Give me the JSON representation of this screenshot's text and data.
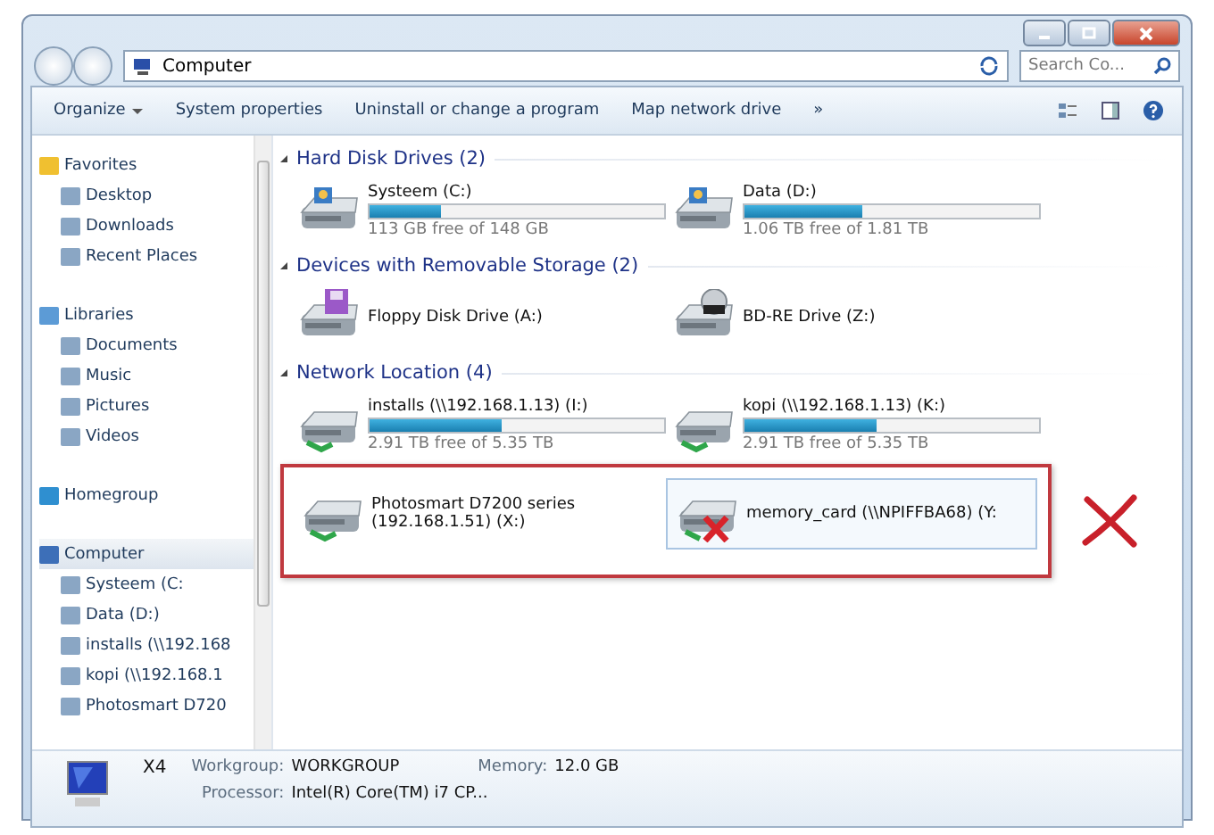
{
  "address_bar": {
    "path": [
      "Computer"
    ]
  },
  "search": {
    "placeholder": "Search Co..."
  },
  "toolbar": {
    "items": [
      {
        "label": "Organize",
        "dropdown": true
      },
      {
        "label": "System properties",
        "dropdown": false
      },
      {
        "label": "Uninstall or change a program",
        "dropdown": false
      },
      {
        "label": "Map network drive",
        "dropdown": false
      },
      {
        "label": "»",
        "dropdown": false
      }
    ]
  },
  "sidebar": {
    "items": [
      {
        "label": "Favorites",
        "selected": false,
        "children": [
          {
            "label": "Desktop",
            "selected": false
          },
          {
            "label": "Downloads",
            "selected": false
          },
          {
            "label": "Recent Places",
            "selected": false
          }
        ]
      },
      {
        "label": "Libraries",
        "selected": false,
        "children": [
          {
            "label": "Documents",
            "selected": false
          },
          {
            "label": "Music",
            "selected": false
          },
          {
            "label": "Pictures",
            "selected": false
          },
          {
            "label": "Videos",
            "selected": false
          }
        ]
      },
      {
        "label": "Homegroup",
        "selected": false
      },
      {
        "label": "Computer",
        "selected": true,
        "children": [
          {
            "label": "Systeem (C:",
            "selected": false
          },
          {
            "label": "Data (D:)",
            "selected": false
          },
          {
            "label": "installs (\\\\192.168",
            "selected": false
          },
          {
            "label": "kopi (\\\\192.168.1",
            "selected": false
          },
          {
            "label": "Photosmart D720",
            "selected": false
          }
        ]
      }
    ]
  },
  "groups": [
    {
      "title": "Hard Disk Drives (2)",
      "expanded": true,
      "items": [
        {
          "kind": "disk",
          "name": "Systeem (C:)",
          "level": 0.24,
          "space": "113 GB free of 148 GB",
          "selected": false,
          "flagged": false
        },
        {
          "kind": "disk",
          "name": "Data (D:)",
          "level": 0.4,
          "space": "1.06 TB free of 1.81 TB",
          "selected": false,
          "flagged": false
        }
      ]
    },
    {
      "title": "Devices with Removable Storage (2)",
      "expanded": true,
      "items": [
        {
          "kind": "floppy",
          "name": "Floppy Disk Drive (A:)",
          "selected": false,
          "flagged": false
        },
        {
          "kind": "optical",
          "name": "BD-RE Drive (Z:)",
          "selected": false,
          "flagged": false
        }
      ]
    },
    {
      "title": "Network Location (4)",
      "expanded": true,
      "items": [
        {
          "kind": "network",
          "name": "installs (\\\\192.168.1.13) (I:)",
          "level": 0.45,
          "space": "2.91 TB free of 5.35 TB",
          "selected": false,
          "flagged": false
        },
        {
          "kind": "network",
          "name": "kopi (\\\\192.168.1.13) (K:)",
          "level": 0.45,
          "space": "2.91 TB free of 5.35 TB",
          "selected": false,
          "flagged": false
        },
        {
          "kind": "network",
          "name": "Photosmart D7200 series (192.168.1.51) (X:)",
          "selected": false,
          "flagged": true
        },
        {
          "kind": "offline",
          "name": "memory_card (\\\\NPIFFBA68) (Y:",
          "selected": true,
          "flagged": true
        }
      ]
    }
  ],
  "details": {
    "computer_name": "X4",
    "fields": [
      {
        "label": "Workgroup:",
        "value": "WORKGROUP"
      },
      {
        "label": "Memory:",
        "value": "12.0 GB"
      },
      {
        "label": "Processor:",
        "value": "Intel(R) Core(TM) i7 CP..."
      }
    ]
  }
}
